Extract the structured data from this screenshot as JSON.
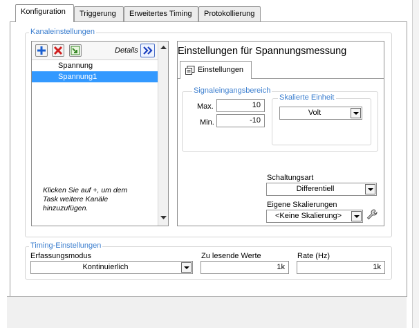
{
  "tabs": [
    "Konfiguration",
    "Triggerung",
    "Erweitertes Timing",
    "Protokollierung"
  ],
  "kanal": {
    "title": "Kanaleinstellungen",
    "details_label": "Details",
    "channels": [
      "Spannung",
      "Spannung1"
    ],
    "hint": [
      "Klicken Sie auf +, um dem",
      "Task weitere Kanäle",
      "hinzuzufügen."
    ]
  },
  "settings": {
    "title": "Einstellungen für Spannungsmessung",
    "tab_label": "Einstellungen",
    "signal_group": "Signaleingangsbereich",
    "max_label": "Max.",
    "max_value": "10",
    "min_label": "Min.",
    "min_value": "-10",
    "scaled_unit_group": "Skalierte Einheit",
    "unit_value": "Volt",
    "wiring_label": "Schaltungsart",
    "wiring_value": "Differentiell",
    "scaling_label": "Eigene Skalierungen",
    "scaling_value": "<Keine Skalierung>"
  },
  "timing": {
    "title": "Timing-Einstellungen",
    "mode_label": "Erfassungsmodus",
    "mode_value": "Kontinuierlich",
    "samples_label": "Zu lesende Werte",
    "samples_value": "1k",
    "rate_label": "Rate (Hz)",
    "rate_value": "1k"
  },
  "colors": {
    "accent": "#3d7fcf",
    "selection": "#3399ff"
  },
  "icons": [
    "add-icon",
    "delete-icon",
    "replace-icon",
    "expand-icon",
    "settings-tab-icon",
    "scaling-wrench-icon",
    "scroll-up-icon",
    "scroll-down-icon"
  ]
}
